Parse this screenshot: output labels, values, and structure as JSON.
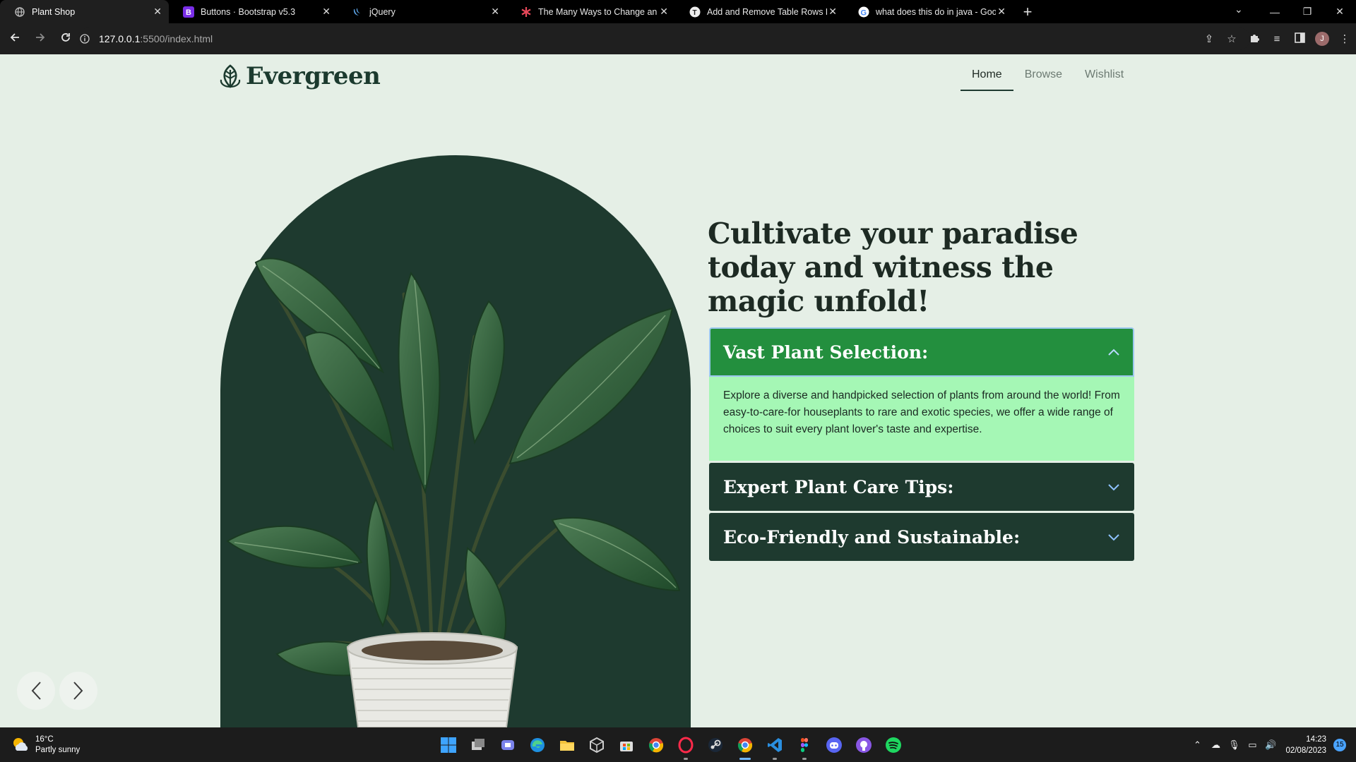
{
  "browser": {
    "tabs": [
      {
        "title": "Plant Shop",
        "active": true
      },
      {
        "title": "Buttons · Bootstrap v5.3",
        "active": false
      },
      {
        "title": "jQuery",
        "active": false
      },
      {
        "title": "The Many Ways to Change an SV",
        "active": false
      },
      {
        "title": "Add and Remove Table Rows Dy",
        "active": false
      },
      {
        "title": "what does this do in java - Goog",
        "active": false
      }
    ],
    "url_host": "127.0.0.1",
    "url_path": ":5500/index.html",
    "profile_initial": "J"
  },
  "site": {
    "brand": "Evergreen",
    "nav": [
      {
        "label": "Home",
        "active": true
      },
      {
        "label": "Browse",
        "active": false
      },
      {
        "label": "Wishlist",
        "active": false
      }
    ],
    "headline": "Cultivate your paradise today and witness the magic unfold!",
    "accordion": [
      {
        "title": "Vast Plant Selection:",
        "open": true,
        "body": "Explore a diverse and handpicked selection of plants from around the world! From easy-to-care-for houseplants to rare and exotic species, we offer a wide range of choices to suit every plant lover's taste and expertise."
      },
      {
        "title": "Expert Plant Care Tips:",
        "open": false
      },
      {
        "title": "Eco-Friendly and Sustainable:",
        "open": false
      }
    ],
    "colors": {
      "dark_green": "#1e3a2f",
      "accent_green": "#238f3e",
      "panel_mint": "#a5f7b5",
      "background": "#e5efe6"
    }
  },
  "taskbar": {
    "weather_temp": "16°C",
    "weather_desc": "Partly sunny",
    "time": "14:23",
    "date": "02/08/2023",
    "notifications": "15"
  }
}
